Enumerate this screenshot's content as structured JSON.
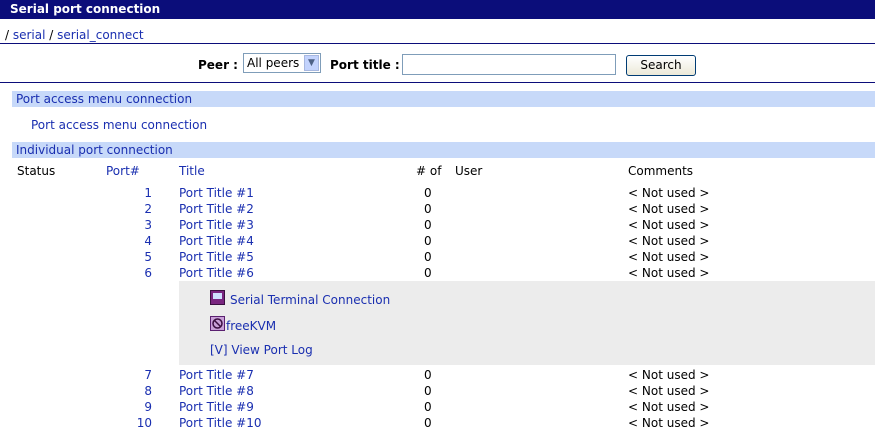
{
  "window": {
    "title": "Serial port connection"
  },
  "breadcrumb": {
    "sep1": "/ ",
    "item1": "serial",
    "sep2": " / ",
    "item2": "serial_connect"
  },
  "search": {
    "peer_label": "Peer :",
    "peer_selected": "All peers",
    "title_label": "Port title :",
    "title_value": "",
    "button_label": "Search"
  },
  "sections": {
    "menu_header": "Port access menu connection",
    "menu_link": "Port access menu connection",
    "individual_header": "Individual port connection"
  },
  "columns": {
    "status": "Status",
    "port": "Port#",
    "title": "Title",
    "count": "# of",
    "user": "User",
    "comments": "Comments"
  },
  "ports_top": [
    {
      "port": "1",
      "title": "Port Title #1",
      "count": "0",
      "comment": "< Not used >"
    },
    {
      "port": "2",
      "title": "Port Title #2",
      "count": "0",
      "comment": "< Not used >"
    },
    {
      "port": "3",
      "title": "Port Title #3",
      "count": "0",
      "comment": "< Not used >"
    },
    {
      "port": "4",
      "title": "Port Title #4",
      "count": "0",
      "comment": "< Not used >"
    },
    {
      "port": "5",
      "title": "Port Title #5",
      "count": "0",
      "comment": "< Not used >"
    },
    {
      "port": "6",
      "title": "Port Title #6",
      "count": "0",
      "comment": "< Not used >"
    }
  ],
  "expanded": {
    "terminal": "Serial Terminal Connection",
    "kvm": "freeKVM",
    "log": "[V] View Port Log"
  },
  "ports_bottom": [
    {
      "port": "7",
      "title": "Port Title #7",
      "count": "0",
      "comment": "< Not used >"
    },
    {
      "port": "8",
      "title": "Port Title #8",
      "count": "0",
      "comment": "< Not used >"
    },
    {
      "port": "9",
      "title": "Port Title #9",
      "count": "0",
      "comment": "< Not used >"
    },
    {
      "port": "10",
      "title": "Port Title #10",
      "count": "0",
      "comment": "< Not used >"
    }
  ]
}
